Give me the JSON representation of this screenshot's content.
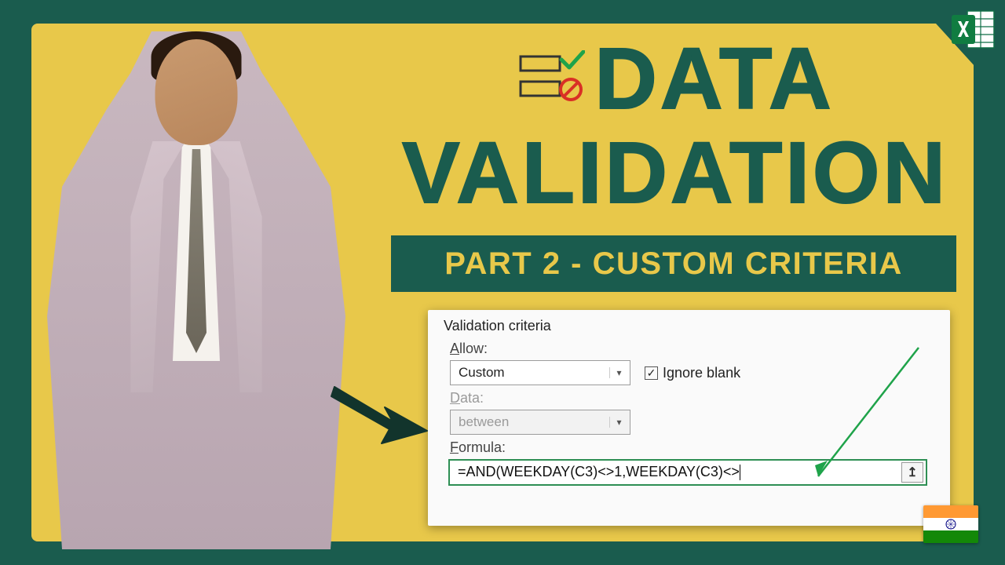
{
  "title": {
    "line1": "DATA",
    "line2": "VALIDATION"
  },
  "subtitle": "PART 2 - CUSTOM CRITERIA",
  "dialog": {
    "heading": "Validation criteria",
    "allow_label_pre": "A",
    "allow_label_post": "llow:",
    "allow_value": "Custom",
    "ignore_blank_pre": "Ignore ",
    "ignore_blank_ul": "b",
    "ignore_blank_post": "lank",
    "data_label_pre": "D",
    "data_label_post": "ata:",
    "data_value": "between",
    "formula_label_pre": "F",
    "formula_label_post": "ormula:",
    "formula_value": "=AND(WEEKDAY(C3)<>1,WEEKDAY(C3)<>"
  },
  "icons": {
    "excel": "excel-icon",
    "data_validation": "data-validation-icon",
    "flag": "india-flag-icon",
    "arrow": "pointer-arrow-icon"
  }
}
